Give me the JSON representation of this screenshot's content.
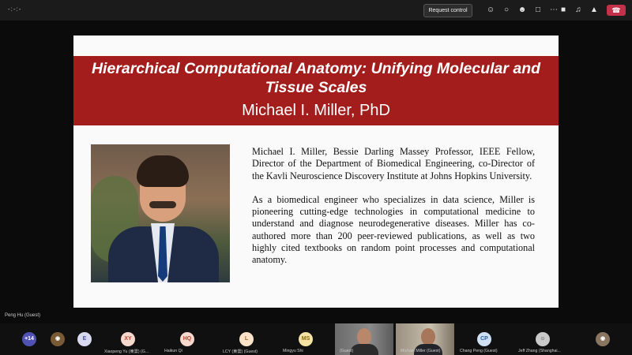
{
  "topbar": {
    "timer": "-:-:-",
    "request_control_label": "Request control",
    "icons": [
      "people-icon",
      "chat-icon",
      "reactions-icon",
      "share-icon",
      "more-icon",
      "camera-icon",
      "mic-icon",
      "share-screen-icon",
      "hangup-icon"
    ]
  },
  "slide": {
    "title": "Hierarchical Computational Anatomy: Unifying Molecular and Tissue Scales",
    "subtitle": "Michael I. Miller, PhD",
    "bio_paragraph_1": "Michael I. Miller, Bessie Darling Massey Professor, IEEE Fellow, Director of the Department of Biomedical Engineering, co-Director of the Kavli Neuroscience Discovery Institute at Johns Hopkins University.",
    "bio_paragraph_2": "As a biomedical engineer who specializes in data science, Miller is pioneering cutting-edge technologies in computational medicine to understand and diagnose neurodegenerative diseases. Miller has co-authored more than 200 peer-reviewed publications, as well as two highly cited textbooks on random point processes and computational anatomy."
  },
  "meeting": {
    "presenter_name": "Peng Hu (Guest)",
    "overflow_count": "+14",
    "participants": [
      {
        "initials": "",
        "name": ""
      },
      {
        "initials": "E",
        "name": ""
      },
      {
        "initials": "XY",
        "name": "Xiaopeng Yu (東雲) (G..."
      },
      {
        "initials": "HQ",
        "name": "Haikun Qi"
      },
      {
        "initials": "L",
        "name": "LCY (東雲) (Guest)"
      },
      {
        "initials": "MS",
        "name": "Mingyu Shi"
      },
      {
        "initials": "",
        "name": "(Guest)"
      },
      {
        "initials": "",
        "name": "Michael Miller (Guest)"
      },
      {
        "initials": "CP",
        "name": "Chang Peng (Guest)"
      },
      {
        "initials": "",
        "name": "Jeff Zhang (Shanghai..."
      },
      {
        "initials": "",
        "name": ""
      }
    ],
    "colors": {
      "title_band": "#a31d1d",
      "hangup": "#c4314b",
      "avatar_bg": "#f6d8cf",
      "avatar_fg": "#b4452f",
      "overflow_bg": "#4f52b2"
    }
  }
}
